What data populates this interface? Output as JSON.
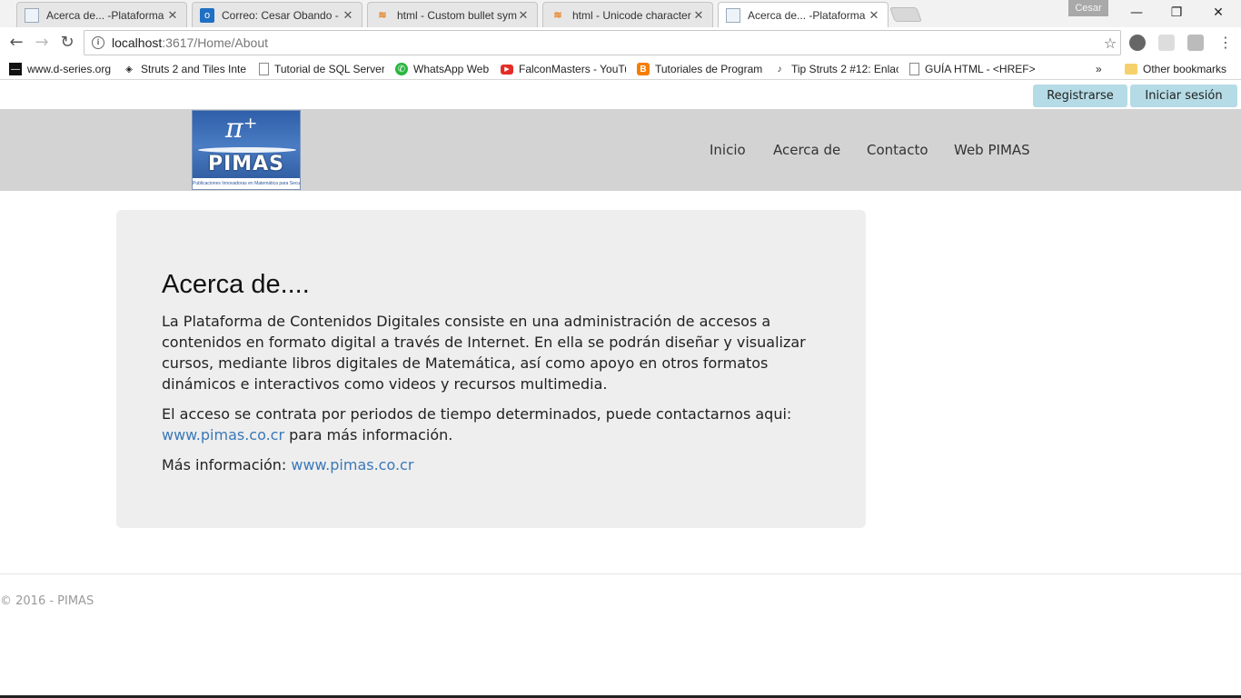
{
  "browser": {
    "tabs": [
      {
        "title": "Acerca de... -Plataforma d",
        "icon": "page-icon",
        "active": false
      },
      {
        "title": "Correo: Cesar Obando - C",
        "icon": "outlook-icon",
        "active": false
      },
      {
        "title": "html - Custom bullet sym",
        "icon": "stackoverflow-icon",
        "active": false
      },
      {
        "title": "html - Unicode character",
        "icon": "stackoverflow-icon",
        "active": false
      },
      {
        "title": "Acerca de... -Plataforma d",
        "icon": "page-icon",
        "active": true
      }
    ],
    "close_glyph": "✕",
    "profile_name": "Cesar",
    "window_controls": {
      "minimize": "—",
      "restore": "❐",
      "close": "✕"
    },
    "nav": {
      "back": "←",
      "forward": "→",
      "reload": "↻"
    },
    "url_host": "localhost",
    "url_rest": ":3617/Home/About",
    "star_glyph": "☆",
    "bookmarks": [
      {
        "label": "www.d-series.org",
        "icon": "d-series-icon"
      },
      {
        "label": "Struts 2 and Tiles Inte",
        "icon": "diamond-icon"
      },
      {
        "label": "Tutorial de SQL Server",
        "icon": "page-icon"
      },
      {
        "label": "WhatsApp Web",
        "icon": "whatsapp-icon"
      },
      {
        "label": "FalconMasters - YouTu",
        "icon": "youtube-icon"
      },
      {
        "label": "Tutoriales de Program",
        "icon": "blogger-icon"
      },
      {
        "label": "Tip Struts 2 #12: Enlac",
        "icon": "tiktok-like-icon"
      },
      {
        "label": "GUÍA HTML - <HREF>",
        "icon": "page-icon"
      }
    ],
    "overflow_glyph": "»",
    "other_bookmarks": "Other bookmarks"
  },
  "site": {
    "auth": {
      "register": "Registrarse",
      "login": "Iniciar sesión"
    },
    "logo": {
      "symbol": "π⁺",
      "brand": "PIMAS",
      "tagline": "Publicaciones Innovadoras en Matemática para Secundaria"
    },
    "menu": [
      "Inicio",
      "Acerca de",
      "Contacto",
      "Web PIMAS"
    ],
    "about": {
      "title": "Acerca de....",
      "p1": "La Plataforma de Contenidos Digitales consiste en una administración de accesos a contenidos en formato digital a través de Internet. En ella se podrán diseñar y visualizar cursos, mediante libros digitales de Matemática, así como apoyo en otros formatos dinámicos e interactivos como videos y recursos multimedia.",
      "p2_before": "El acceso se contrata por periodos de tiempo determinados, puede contactarnos aqui: ",
      "p2_link": "www.pimas.co.cr",
      "p2_after": " para más información.",
      "p3_before": "Más información: ",
      "p3_link": "www.pimas.co.cr"
    },
    "footer": "© 2016 - PIMAS"
  },
  "colors": {
    "navbar": "#d3d3d3",
    "auth_button": "#b5dbe6",
    "link": "#3a78b8",
    "jumbotron": "#eeeeee"
  }
}
